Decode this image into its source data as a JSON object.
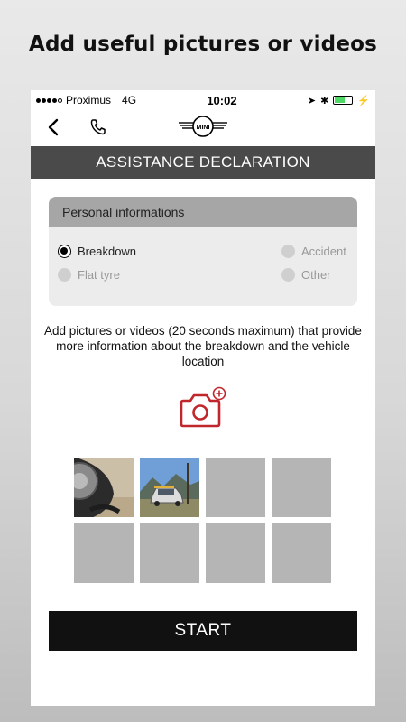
{
  "promo": {
    "title": "Add useful pictures or videos"
  },
  "status_bar": {
    "carrier": "Proximus",
    "network": "4G",
    "time": "10:02"
  },
  "nav": {
    "back_icon": "chevron-left-icon",
    "call_icon": "phone-icon",
    "logo_text": "MINI"
  },
  "header": {
    "title": "ASSISTANCE DECLARATION"
  },
  "personal_info": {
    "title": "Personal informations",
    "options": [
      {
        "label": "Breakdown",
        "selected": true
      },
      {
        "label": "Accident",
        "selected": false
      },
      {
        "label": "Flat tyre",
        "selected": false
      },
      {
        "label": "Other",
        "selected": false
      }
    ]
  },
  "media": {
    "instructions": "Add pictures or videos (20 seconds maximum) that provide more information about the breakdown and the vehicle location",
    "add_icon": "add-camera-icon",
    "slots_total": 8,
    "slots_filled": 2,
    "accent_color": "#c0272d"
  },
  "actions": {
    "start_label": "START"
  },
  "colors": {
    "title_bar": "#4a4a4a",
    "card_header": "#a6a6a6",
    "start_button": "#111111"
  }
}
